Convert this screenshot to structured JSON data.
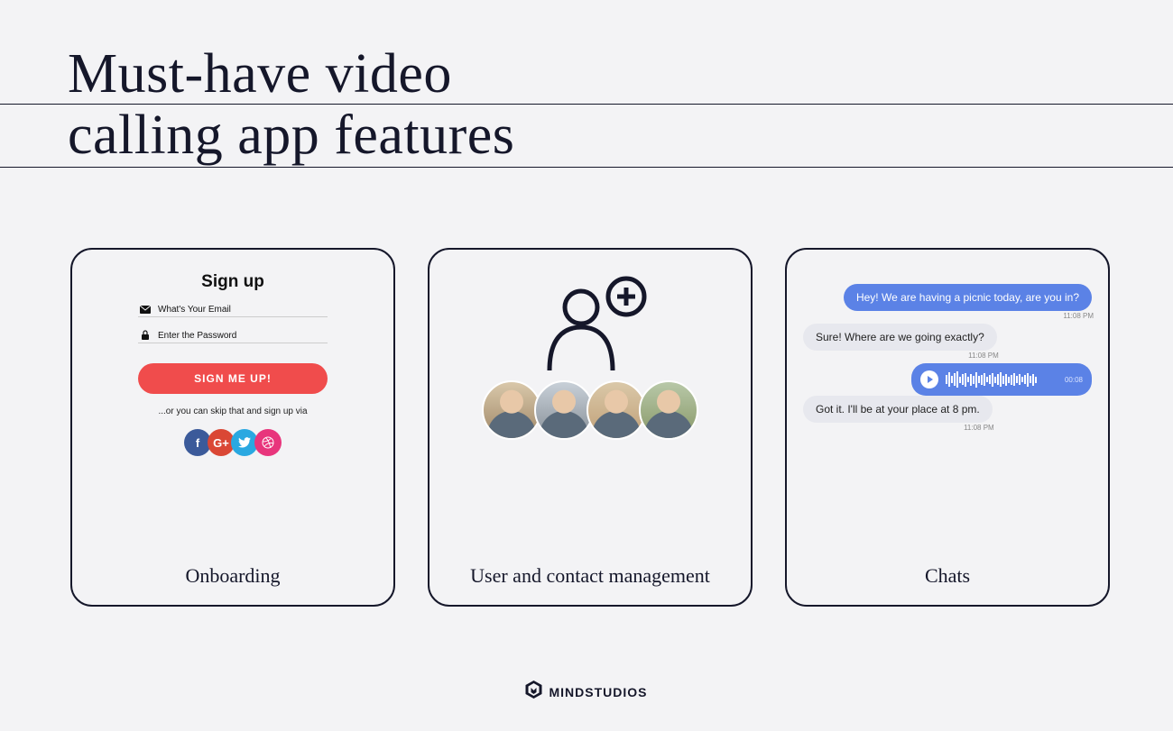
{
  "title_line1": "Must-have video",
  "title_line2": "calling app features",
  "cards": {
    "onboarding": {
      "label": "Onboarding",
      "signup_heading": "Sign up",
      "email_placeholder": "What's Your Email",
      "password_placeholder": "Enter the Password",
      "button": "SIGN ME UP!",
      "skip_text": "...or you can skip that and sign up via",
      "socials": {
        "facebook": "f",
        "google": "G+",
        "twitter": "t",
        "dribbble": "●"
      }
    },
    "contacts": {
      "label": "User and contact management"
    },
    "chats": {
      "label": "Chats",
      "msg1": "Hey! We are having a picnic today, are you in?",
      "ts1": "11:08 PM",
      "msg2": "Sure! Where are we going exactly?",
      "ts2": "11:08 PM",
      "audio_time": "00:08",
      "msg3": "Got it. I'll be at your place at 8 pm.",
      "ts3": "11:08 PM"
    }
  },
  "footer": {
    "brand": "MINDSTUDIOS"
  }
}
